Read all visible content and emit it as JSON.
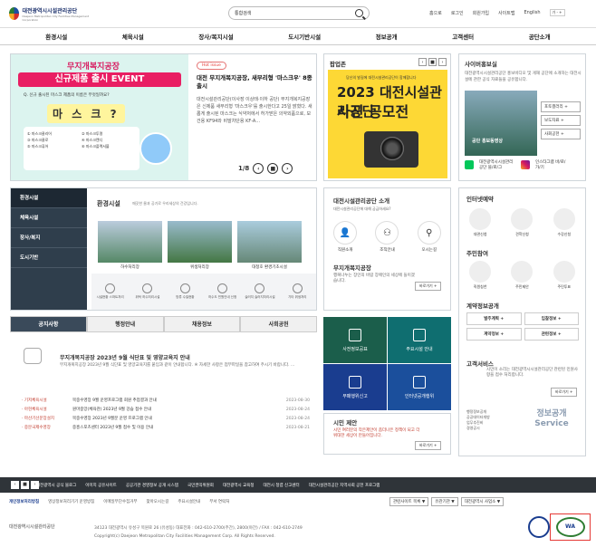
{
  "header": {
    "logo_name": "대전광역시시설관리공단",
    "logo_sub": "Daejeon Metropolitan City Facilities Management Corporation",
    "search_select": "통합검색",
    "toplinks": [
      "홈으로",
      "로그인",
      "회원가입",
      "사이트맵",
      "English"
    ],
    "font_control": "가 - +",
    "menu": [
      "환경시설",
      "체육시설",
      "장사/복지시설",
      "도시기반시설",
      "정보공개",
      "고객센터",
      "공단소개"
    ]
  },
  "event": {
    "line1": "무지개복지공장",
    "line2": "신규제품 출시 EVENT",
    "question": "Q. 신규 출시된 마스크 제품의 이름은 무엇일까요?",
    "mask": "마 스 크 ?",
    "options": [
      "① 마스크클리어",
      "② 마스크투명",
      "③ 마스크클로",
      "④ 마스크캔디",
      "⑤ 마스크퓨어",
      "⑥ 마스크플렉서블"
    ]
  },
  "news": {
    "tag": "Hot issue",
    "title": "대전 무지개복지공장, 새부리형 '마스크우' 8종 출시",
    "body": "대전시설관리공단(이사장 이상태·이하 공단) 무지개복지공장은 신제품 새부리형 '마스크우'를 출시한다고 25일 밝혔다. 새롭게 출시된 마스크는 식약처에서 허가받은 의약외품으로, 보건용 KF94와 비말차단용 KF-A...",
    "page": "1/8"
  },
  "popup": {
    "title": "팝업존",
    "img_line1": "당신의 발길에 대전시설관리공단이 함께합니다",
    "img_line2": "2023 대전시설관리공단",
    "img_line3": "사진 공모전"
  },
  "cyber": {
    "title": "사이버홍보실",
    "text": "대전광역시시설관리공단 홍보비디오 및 게재 공단에 소개하는 대전시설에 관한 공식 자료들을 공유합니다.",
    "caption": "공단 홍보동영상",
    "buttons": [
      "포토갤러리 +",
      "보도자료 +",
      "사회공헌 +"
    ],
    "sns": [
      "대전광역시시설관리공단 블/로/그",
      "인스타그램 바/로/가/기"
    ]
  },
  "env": {
    "side": [
      "환경시설",
      "체육시설",
      "장사/복지",
      "도시기반"
    ],
    "title": "환경시설",
    "sub": "깨끗한 물과 공기로 우리세상의 건강입니다.",
    "captions": [
      "하수처리장",
      "위생처리장",
      "대청호 환경기초시설"
    ],
    "icons": [
      "시설현황 스마트처리",
      "위탁 하수처리시설",
      "방류 수질현황",
      "하수도 민원안내 신청",
      "슬러지 슬러지처리시설",
      "기타 위생처리"
    ]
  },
  "intro": {
    "title": "대전시설관리공단 소개",
    "sub": "대전시설관리공단에 대해 궁금하세요?",
    "items": [
      "직원소개",
      "조직안내",
      "오시는길"
    ],
    "mask_title": "무지개복지공장",
    "mask_text": "행복나누는 장인의 바람 장애인의 세상에 들이겠습니다.",
    "more": "바로가기 +"
  },
  "right": {
    "reserve_title": "인터넷예약",
    "reserve": [
      "대관신청",
      "견학신청",
      "수강신청"
    ],
    "part_title": "주민참여",
    "part": [
      "직원칭찬",
      "주민제안",
      "주민투표"
    ],
    "contract_title": "계약정보공개",
    "contract": [
      "발주계획 +",
      "입찰정보 +",
      "계약정보 +",
      "관련정보 +"
    ],
    "cs_title": "고객서비스",
    "cs_text": "시민이 소리는 대전광역시시설관리공단 관련된 민원사항을 접수 처리합니다.",
    "cs_more": "바로가기 +",
    "info_items": [
      "행정정보공개",
      "공공데이터개방",
      "업무추진비",
      "경영공시"
    ],
    "info_label": "정보공개 Service"
  },
  "notice": {
    "tabs": [
      "공지사항",
      "행정안내",
      "채용정보",
      "사회공헌"
    ],
    "headline": "무지개복지공장 2023년 9월 식단표 및 영양교육지 안내",
    "headline_body": "무지개복지공장 2023년 9월 식단표 및 영양교육지를 붙임과 같이 안내합니다. ※ 자세한 사항은 첨부파일을 참고하여 주시기 바랍니다. ...",
    "rows": [
      {
        "cat": "· 기저체육시설",
        "title": "목중수영장 9월 운영프로그램 회원 추첨결과 안내",
        "date": "2023-08-30"
      },
      {
        "cat": "· 아현체육시설",
        "title": "원마중앙(체육관) 2023년 9월 강습 접수 안내",
        "date": "2023-08-24"
      },
      {
        "cat": "· 마산기선문장설치",
        "title": "목중수영장 2023년 9월분 운영 프로그램 안내",
        "date": "2023-08-24"
      },
      {
        "cat": "· 중분국제수영장",
        "title": "중흥스포츠센터 2023년 9월 접수 및 이용 안내",
        "date": "2023-08-21"
      }
    ]
  },
  "tiles": [
    "사전정보공표",
    "주요시설 안내",
    "부패행위신고",
    "인터넷공개행위"
  ],
  "proposal": {
    "title": "시민 제안",
    "text": "시민 여러분의 작은제안이 좀더나은 정책이 되고 더 위대한 세상이 만들어집니다.",
    "more": "바로가기 +"
  },
  "footer": {
    "banner_items": [
      "대전광역시 공식 블로그",
      "이미지 공유사이트",
      "공공기관 경영정보 공개 시스템",
      "국민권익위원회",
      "대전광역시 교육청",
      "대전시 청렴 신고센터",
      "대전시설관리공단 지역사회 공헌 프로그램"
    ],
    "links": [
      "개인정보처리방침",
      "영상정보처리기기 운영방침",
      "이메일무단수집거부",
      "찾아오시는길",
      "주요시설안내",
      "부서 연락처"
    ],
    "selects": [
      "관련사이트 목록 ▼",
      "유관기관 ▼",
      "대전광역시 사업소 ▼"
    ],
    "logo": "대전광역시시설관리공단",
    "address": "34123 대전광역시 유성구 목원로 26 (유성동) 대표전화 : 042-610-2700(주간), 2800(야간) / FAX : 042-610-2749",
    "copyright": "Copyright(c) Daejeon Metropolitan City Facilities Management Corp. All Rights Reserved.",
    "cert_label": "WA"
  }
}
